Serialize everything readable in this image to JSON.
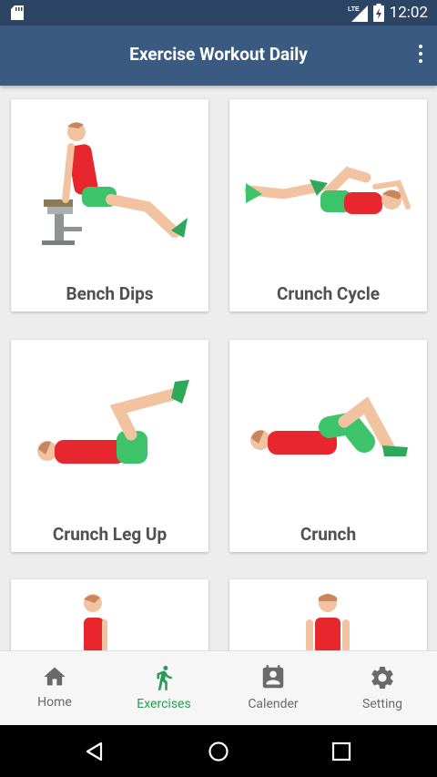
{
  "status_bar": {
    "network": "LTE",
    "time": "12:02"
  },
  "app_bar": {
    "title": "Exercise Workout Daily"
  },
  "exercises": [
    {
      "label": "Bench Dips"
    },
    {
      "label": "Crunch Cycle"
    },
    {
      "label": "Crunch Leg Up"
    },
    {
      "label": "Crunch"
    },
    {
      "label": ""
    },
    {
      "label": ""
    }
  ],
  "bottom_nav": {
    "items": [
      {
        "label": "Home",
        "icon": "home-icon"
      },
      {
        "label": "Exercises",
        "icon": "walking-person-icon",
        "active": true
      },
      {
        "label": "Calender",
        "icon": "calendar-contact-icon"
      },
      {
        "label": "Setting",
        "icon": "gear-icon"
      }
    ],
    "active_color": "#2b9b54"
  }
}
